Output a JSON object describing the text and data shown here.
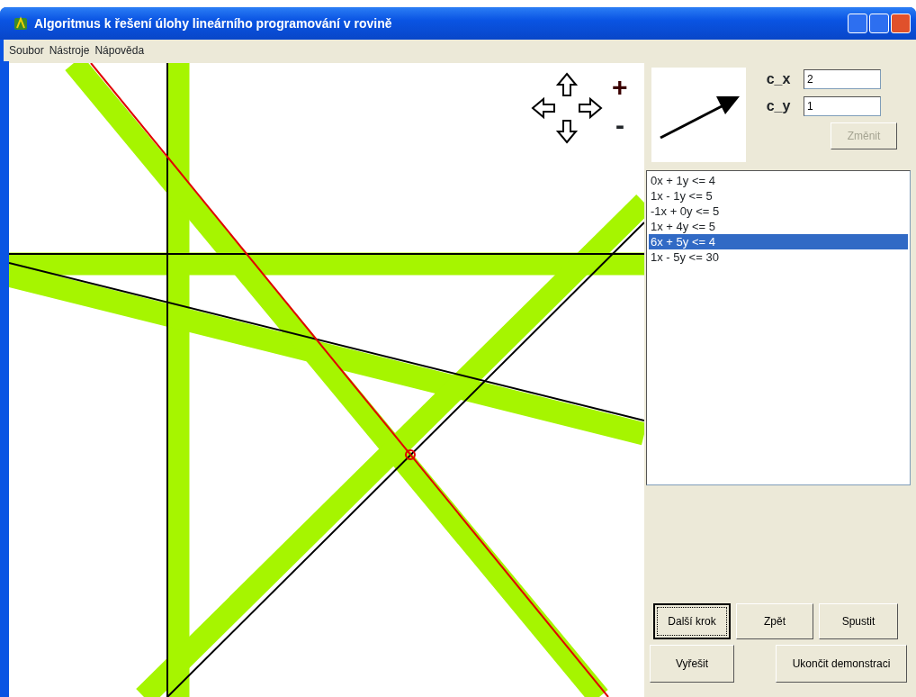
{
  "window": {
    "title": "Algoritmus k řešení úlohy lineárního programování v rovině"
  },
  "menu": [
    "Soubor",
    "Nástroje",
    "Nápověda"
  ],
  "zoom": {
    "plus": "+",
    "minus": "-"
  },
  "objective": {
    "fields": [
      {
        "label": "c_x",
        "value": "2"
      },
      {
        "label": "c_y",
        "value": "1"
      }
    ],
    "change_button": {
      "label": "Změnit",
      "disabled": true
    }
  },
  "constraints": [
    {
      "text": "0x + 1y <= 4",
      "selected": false
    },
    {
      "text": "1x - 1y <= 5",
      "selected": false
    },
    {
      "text": "-1x + 0y <= 5",
      "selected": false
    },
    {
      "text": "1x + 4y <= 5",
      "selected": false
    },
    {
      "text": "6x + 5y <= 4",
      "selected": true
    },
    {
      "text": "1x - 5y <= 30",
      "selected": false
    }
  ],
  "buttons": [
    {
      "label": "Další krok",
      "focused": true
    },
    {
      "label": "Zpět",
      "focused": false
    },
    {
      "label": "Spustit",
      "focused": false
    },
    {
      "label": "Vyřešit",
      "focused": false
    },
    {
      "label": "Ukončit demonstraci",
      "focused": false
    }
  ]
}
